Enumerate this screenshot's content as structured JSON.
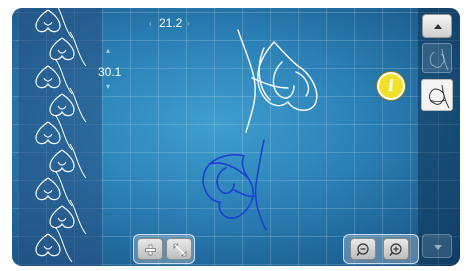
{
  "measurements": {
    "width": "21.2",
    "height": "30.1"
  },
  "icons": {
    "info": "info-icon",
    "scroll_up": "triangle-up-icon",
    "scroll_down": "triangle-down-icon",
    "add": "plus-icon",
    "expand": "expand-arrows-icon",
    "zoom_out": "zoom-out-icon",
    "zoom_in": "zoom-in-icon"
  },
  "info_label": "i",
  "colors": {
    "stitch_white": "#ffffff",
    "stitch_blue": "#1e3fd4",
    "info_yellow": "#f2e12a",
    "background_blue": "#2a7fb4"
  }
}
